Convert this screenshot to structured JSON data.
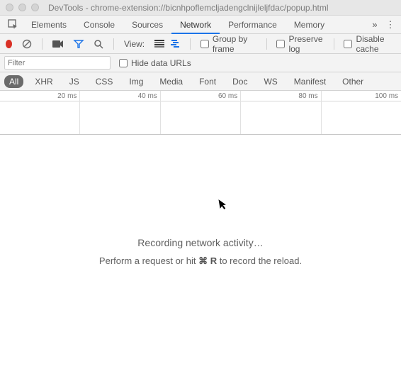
{
  "window": {
    "title": "DevTools - chrome-extension://bicnhpoflemcljadengclnijleljfdac/popup.html"
  },
  "tabs": {
    "items": [
      "Elements",
      "Console",
      "Sources",
      "Network",
      "Performance",
      "Memory"
    ],
    "active": "Network",
    "overflow_glyph": "»",
    "menu_glyph": "⋮"
  },
  "toolbar": {
    "view_label": "View:",
    "group_by_frame": "Group by frame",
    "preserve_log": "Preserve log",
    "disable_cache": "Disable cache"
  },
  "filter": {
    "placeholder": "Filter",
    "hide_data_urls": "Hide data URLs"
  },
  "types": {
    "items": [
      "All",
      "XHR",
      "JS",
      "CSS",
      "Img",
      "Media",
      "Font",
      "Doc",
      "WS",
      "Manifest",
      "Other"
    ],
    "active": "All"
  },
  "timeline": {
    "ticks": [
      "20 ms",
      "40 ms",
      "60 ms",
      "80 ms",
      "100 ms"
    ]
  },
  "message": {
    "recording": "Recording network activity…",
    "hint_pre": "Perform a request or hit ",
    "hint_key": "⌘ R",
    "hint_post": " to record the reload."
  }
}
